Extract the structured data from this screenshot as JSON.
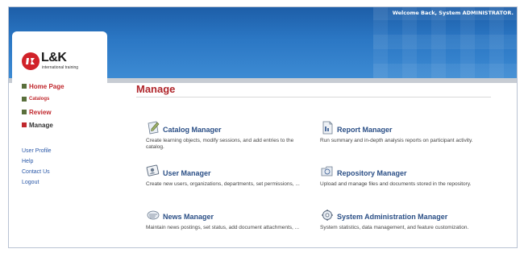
{
  "header": {
    "welcome": "Welcome Back, System ADMINISTRATOR."
  },
  "logo": {
    "mark": "l-k",
    "name": "L&K",
    "tagline": "international training"
  },
  "nav": {
    "items": [
      {
        "label": "Home Page"
      },
      {
        "label": "Catalogs"
      },
      {
        "label": "Review"
      },
      {
        "label": "Manage"
      }
    ]
  },
  "links": {
    "items": [
      {
        "label": "User Profile"
      },
      {
        "label": "Help"
      },
      {
        "label": "Contact Us"
      },
      {
        "label": "Logout"
      }
    ]
  },
  "main": {
    "title": "Manage",
    "modules": [
      {
        "title": "Catalog Manager",
        "desc": "Create learning objects, modify sessions, and add entries to the catalog.",
        "icon": "pencil-paper-icon"
      },
      {
        "title": "Report Manager",
        "desc": "Run summary and in-depth analysis reports on participant activity.",
        "icon": "document-icon"
      },
      {
        "title": "User Manager",
        "desc": "Create new users, organizations, departments, set permissions, ...",
        "icon": "id-card-icon"
      },
      {
        "title": "Repository Manager",
        "desc": "Upload and manage files and documents stored in the repository.",
        "icon": "folder-icon"
      },
      {
        "title": "News Manager",
        "desc": "Maintain news postings, set status, add document attachments, ...",
        "icon": "newspaper-icon"
      },
      {
        "title": "System Administration Manager",
        "desc": "System statistics, data management, and feature customization.",
        "icon": "gear-icon"
      }
    ]
  },
  "colors": {
    "header_blue": "#2b77c4",
    "accent_red": "#c0282d",
    "module_title": "#2b4f86",
    "link_blue": "#2a58a8"
  }
}
